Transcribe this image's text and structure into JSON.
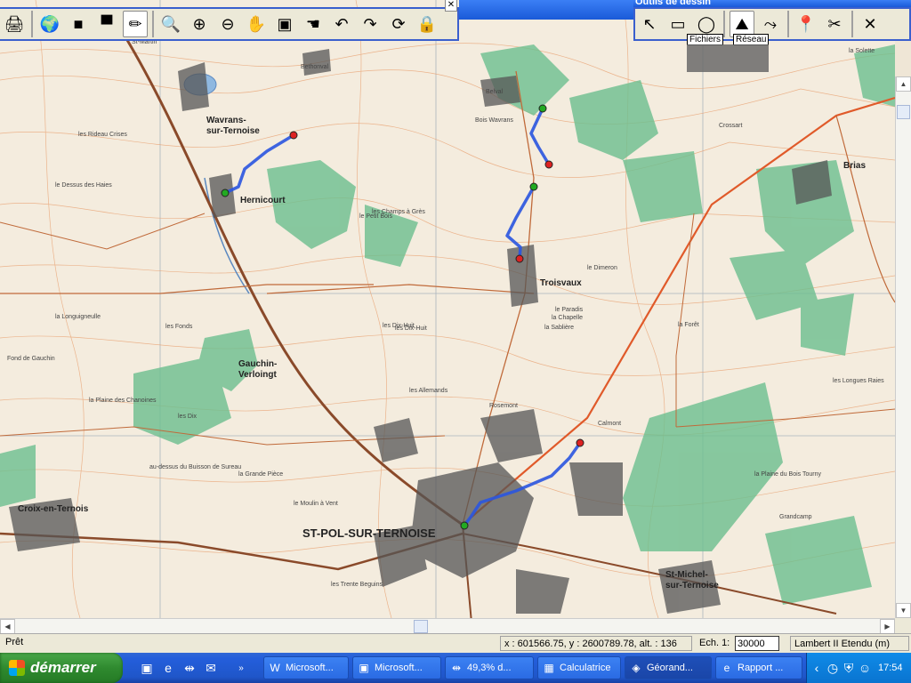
{
  "toolbar_main": {
    "buttons": [
      {
        "name": "print-icon",
        "glyph": "🖨"
      },
      {
        "name": "globe-open-icon",
        "glyph": "🌍"
      },
      {
        "name": "layer-gray-icon",
        "glyph": "■"
      },
      {
        "name": "layer-gray2-icon",
        "glyph": "▀"
      },
      {
        "name": "pencil-edit-icon",
        "glyph": "✏"
      },
      {
        "name": "zoom-icon",
        "glyph": "🔍"
      },
      {
        "name": "zoom-in-icon",
        "glyph": "⊕"
      },
      {
        "name": "zoom-out-icon",
        "glyph": "⊖"
      },
      {
        "name": "pan-hand-zoom-icon",
        "glyph": "✋"
      },
      {
        "name": "zoom-window-icon",
        "glyph": "▣"
      },
      {
        "name": "pan-hand-icon",
        "glyph": "☚"
      },
      {
        "name": "undo-icon",
        "glyph": "↶"
      },
      {
        "name": "redo-icon",
        "glyph": "↷"
      },
      {
        "name": "refresh-icon",
        "glyph": "⟳"
      },
      {
        "name": "lock-icon",
        "glyph": "🔒"
      }
    ]
  },
  "drawing_tools": {
    "title": "Outils de dessin",
    "buttons": [
      {
        "name": "pointer-icon",
        "glyph": "↖"
      },
      {
        "name": "rectangle-select-icon",
        "glyph": "▭"
      },
      {
        "name": "circle-select-icon",
        "glyph": "◯"
      },
      {
        "name": "profile-icon",
        "glyph": "⛰"
      },
      {
        "name": "network-route-icon",
        "glyph": "⤳"
      },
      {
        "name": "marker-icon",
        "glyph": "📍"
      },
      {
        "name": "scissors-icon",
        "glyph": "✂"
      },
      {
        "name": "delete-icon",
        "glyph": "✕"
      }
    ],
    "tooltip_files": "Fichiers",
    "tooltip_network": "Réseau"
  },
  "map_labels": [
    {
      "text": "ST-POL-SUR-TERNOISE",
      "cls": "big"
    },
    {
      "text": "Troisvaux",
      "cls": "med"
    },
    {
      "text": "Hernicourt",
      "cls": "med"
    },
    {
      "text": "Wavrans-",
      "cls": "med"
    },
    {
      "text": "sur-Ternoise",
      "cls": "med"
    },
    {
      "text": "Gauchin-",
      "cls": "med"
    },
    {
      "text": "Verloingt",
      "cls": "med"
    },
    {
      "text": "Croix-en-Ternois",
      "cls": "med"
    },
    {
      "text": "Brias",
      "cls": "med"
    },
    {
      "text": "St-Michel-",
      "cls": "med"
    },
    {
      "text": "sur-Ternoise",
      "cls": "med"
    },
    {
      "text": "Bethonval",
      "cls": "small"
    },
    {
      "text": "la Grande Pièce",
      "cls": "small"
    },
    {
      "text": "le Dimeron",
      "cls": "small"
    },
    {
      "text": "la Forêt",
      "cls": "small"
    },
    {
      "text": "Grandcamp",
      "cls": "small"
    },
    {
      "text": "St-Martin",
      "cls": "small"
    },
    {
      "text": "Belval",
      "cls": "small"
    },
    {
      "text": "Crossart",
      "cls": "small"
    },
    {
      "text": "Rosemont",
      "cls": "small"
    },
    {
      "text": "la Chapelle",
      "cls": "small"
    },
    {
      "text": "la Sablière",
      "cls": "small"
    },
    {
      "text": "les Dix-Huit",
      "cls": "small"
    },
    {
      "text": "Calmont",
      "cls": "small"
    },
    {
      "text": "le Paradis",
      "cls": "small"
    },
    {
      "text": "la Solette",
      "cls": "small"
    },
    {
      "text": "Bois Wavrans",
      "cls": "small"
    },
    {
      "text": "les Allemands",
      "cls": "small"
    },
    {
      "text": "la Plaine du Bois Tourny",
      "cls": "small"
    },
    {
      "text": "le Moulin à Vent",
      "cls": "small"
    },
    {
      "text": "les Fonds",
      "cls": "small"
    },
    {
      "text": "le Petit Bois",
      "cls": "small"
    },
    {
      "text": "les Longues Raies",
      "cls": "small"
    },
    {
      "text": "les Trente Beguins",
      "cls": "small"
    },
    {
      "text": "les Champs à Grès",
      "cls": "small"
    },
    {
      "text": "au-dessus du Buisson de Sureau",
      "cls": "small"
    },
    {
      "text": "Fond de Gauchin",
      "cls": "small"
    },
    {
      "text": "la Longuigneulle",
      "cls": "small"
    },
    {
      "text": "le Dessus des Haies",
      "cls": "small"
    },
    {
      "text": "les Dix-Huit",
      "cls": "small"
    },
    {
      "text": "les Rideau Crises",
      "cls": "small"
    },
    {
      "text": "les Dix",
      "cls": "small"
    },
    {
      "text": "la Plaine des Chanoines",
      "cls": "small"
    }
  ],
  "status": {
    "ready": "Prêt",
    "coords": "x : 601566.75, y : 2600789.78, alt. : 136 m",
    "scale_label": "Ech. 1:",
    "scale_value": "30000",
    "projection": "Lambert II Etendu (m)"
  },
  "taskbar": {
    "start": "démarrer",
    "tasks": [
      {
        "label": "Microsoft...",
        "icon": "W"
      },
      {
        "label": "Microsoft...",
        "icon": "▣"
      },
      {
        "label": "49,3% d...",
        "icon": "⇹"
      },
      {
        "label": "Calculatrice",
        "icon": "▦"
      },
      {
        "label": "Géorand...",
        "icon": "◈"
      },
      {
        "label": "Rapport ...",
        "icon": "e"
      }
    ],
    "clock": "17:54"
  },
  "colors": {
    "route": "#2a55e0",
    "endpoint_start": "#22aa22",
    "endpoint_end": "#dd2222",
    "forest": "#6cbf8f",
    "contour": "#e8a070",
    "road_main": "#e05a2a"
  }
}
